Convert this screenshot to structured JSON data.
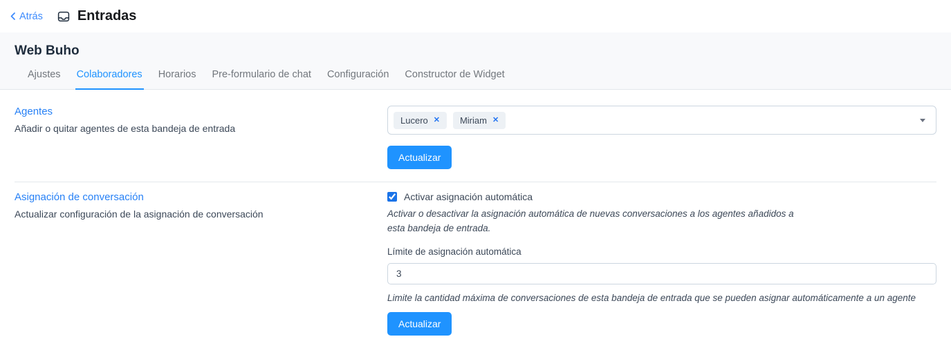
{
  "topbar": {
    "back_label": "Atrás",
    "title": "Entradas"
  },
  "inbox": {
    "name": "Web Buho",
    "tabs": [
      "Ajustes",
      "Colaboradores",
      "Horarios",
      "Pre-formulario de chat",
      "Configuración",
      "Constructor de Widget"
    ],
    "active_tab": "Colaboradores"
  },
  "agents_section": {
    "title": "Agentes",
    "description": "Añadir o quitar agentes de esta bandeja de entrada",
    "selected": [
      "Lucero",
      "Miriam"
    ],
    "remove_icon": "✕",
    "update_button": "Actualizar"
  },
  "assignment_section": {
    "title": "Asignación de conversación",
    "description": "Actualizar configuración de la asignación de conversación",
    "auto_assignment": {
      "label": "Activar asignación automática",
      "checked": true,
      "help": "Activar o desactivar la asignación automática de nuevas conversaciones a los agentes añadidos a esta bandeja de entrada."
    },
    "limit": {
      "label": "Límite de asignación automática",
      "value": "3",
      "help": "Limite la cantidad máxima de conversaciones de esta bandeja de entrada que se pueden asignar automáticamente a un agente"
    },
    "update_button": "Actualizar"
  },
  "colors": {
    "accent_blue": "#1f93ff",
    "heading_blue": "#2781f6",
    "link_blue": "#3d8bfd",
    "checkbox_blue": "#1a73e8",
    "band_background": "#f8f9fb",
    "tag_background": "#edf1f5",
    "border_light": "#ccd6e0",
    "text_dark": "#1f2d3d",
    "text_body": "#3c4858",
    "tab_inactive": "#72777d"
  }
}
